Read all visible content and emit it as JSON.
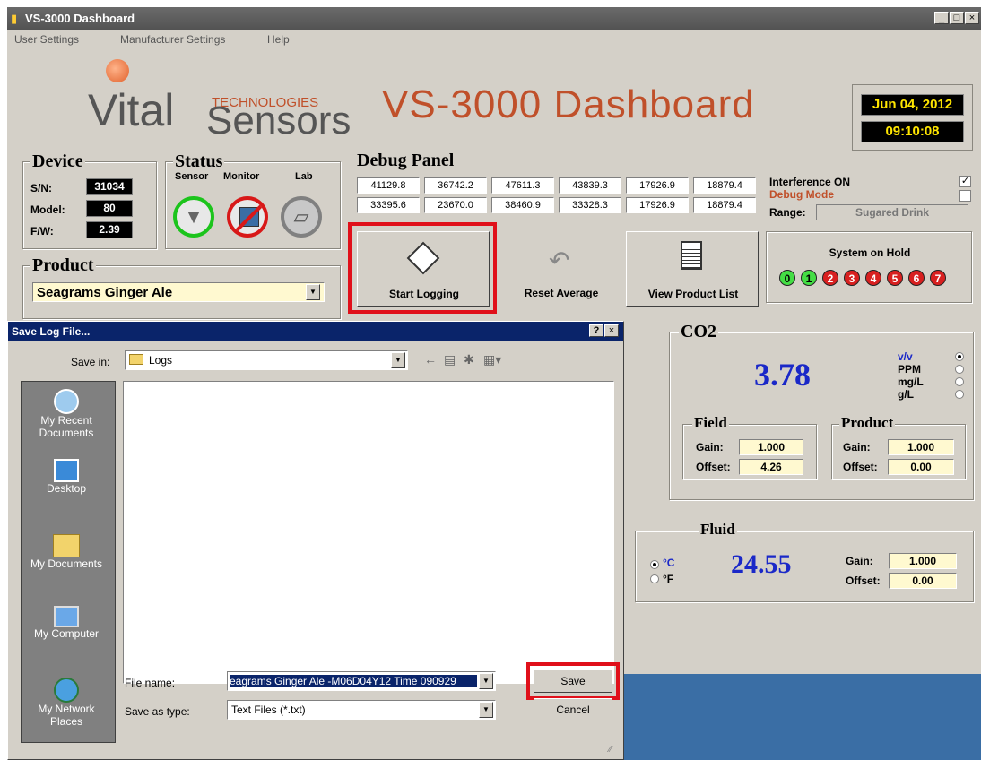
{
  "window": {
    "title": "VS-3000 Dashboard"
  },
  "menu": [
    "User Settings",
    "Manufacturer Settings",
    "Help"
  ],
  "logo": {
    "vital": "Vital",
    "sensors": "Sensors",
    "technologies": "TECHNOLOGIES"
  },
  "header": {
    "title": "VS-3000 Dashboard",
    "date": "Jun 04, 2012",
    "time": "09:10:08"
  },
  "device": {
    "title": "Device",
    "sn_label": "S/N:",
    "sn": "31034",
    "model_label": "Model:",
    "model": "80",
    "fw_label": "F/W:",
    "fw": "2.39"
  },
  "status": {
    "title": "Status",
    "labels": [
      "Sensor",
      "Monitor",
      "Lab"
    ]
  },
  "product": {
    "title": "Product",
    "selected": "Seagrams Ginger Ale"
  },
  "debug": {
    "title": "Debug Panel",
    "row1": [
      "41129.8",
      "36742.2",
      "47611.3",
      "43839.3",
      "17926.9",
      "18879.4"
    ],
    "row2": [
      "33395.6",
      "23670.0",
      "38460.9",
      "33328.3",
      "17926.9",
      "18879.4"
    ],
    "interference": "Interference ON",
    "debug_mode": "Debug Mode",
    "range_label": "Range:",
    "range_value": "Sugared Drink"
  },
  "actions": {
    "start_logging": "Start Logging",
    "reset_average": "Reset Average",
    "view_product_list": "View Product List"
  },
  "system": {
    "label": "System on Hold",
    "leds": [
      "0",
      "1",
      "2",
      "3",
      "4",
      "5",
      "6",
      "7"
    ]
  },
  "co2": {
    "title": "CO2",
    "value": "3.78",
    "units": [
      "v/v",
      "PPM",
      "mg/L",
      "g/L"
    ],
    "field": {
      "title": "Field",
      "gain_label": "Gain:",
      "gain": "1.000",
      "offset_label": "Offset:",
      "offset": "4.26"
    },
    "product": {
      "title": "Product",
      "gain_label": "Gain:",
      "gain": "1.000",
      "offset_label": "Offset:",
      "offset": "0.00"
    }
  },
  "fluid": {
    "title": "Fluid",
    "value": "24.55",
    "units": [
      "°C",
      "°F"
    ],
    "gain_label": "Gain:",
    "gain": "1.000",
    "offset_label": "Offset:",
    "offset": "0.00"
  },
  "dialog": {
    "title": "Save Log File...",
    "save_in_label": "Save in:",
    "save_in_value": "Logs",
    "places": [
      "My Recent Documents",
      "Desktop",
      "My Documents",
      "My Computer",
      "My Network Places"
    ],
    "file_name_label": "File name:",
    "file_name_value": "eagrams Ginger Ale -M06D04Y12 Time 090929",
    "save_type_label": "Save as type:",
    "save_type_value": "Text Files (*.txt)",
    "save_button": "Save",
    "cancel_button": "Cancel"
  }
}
